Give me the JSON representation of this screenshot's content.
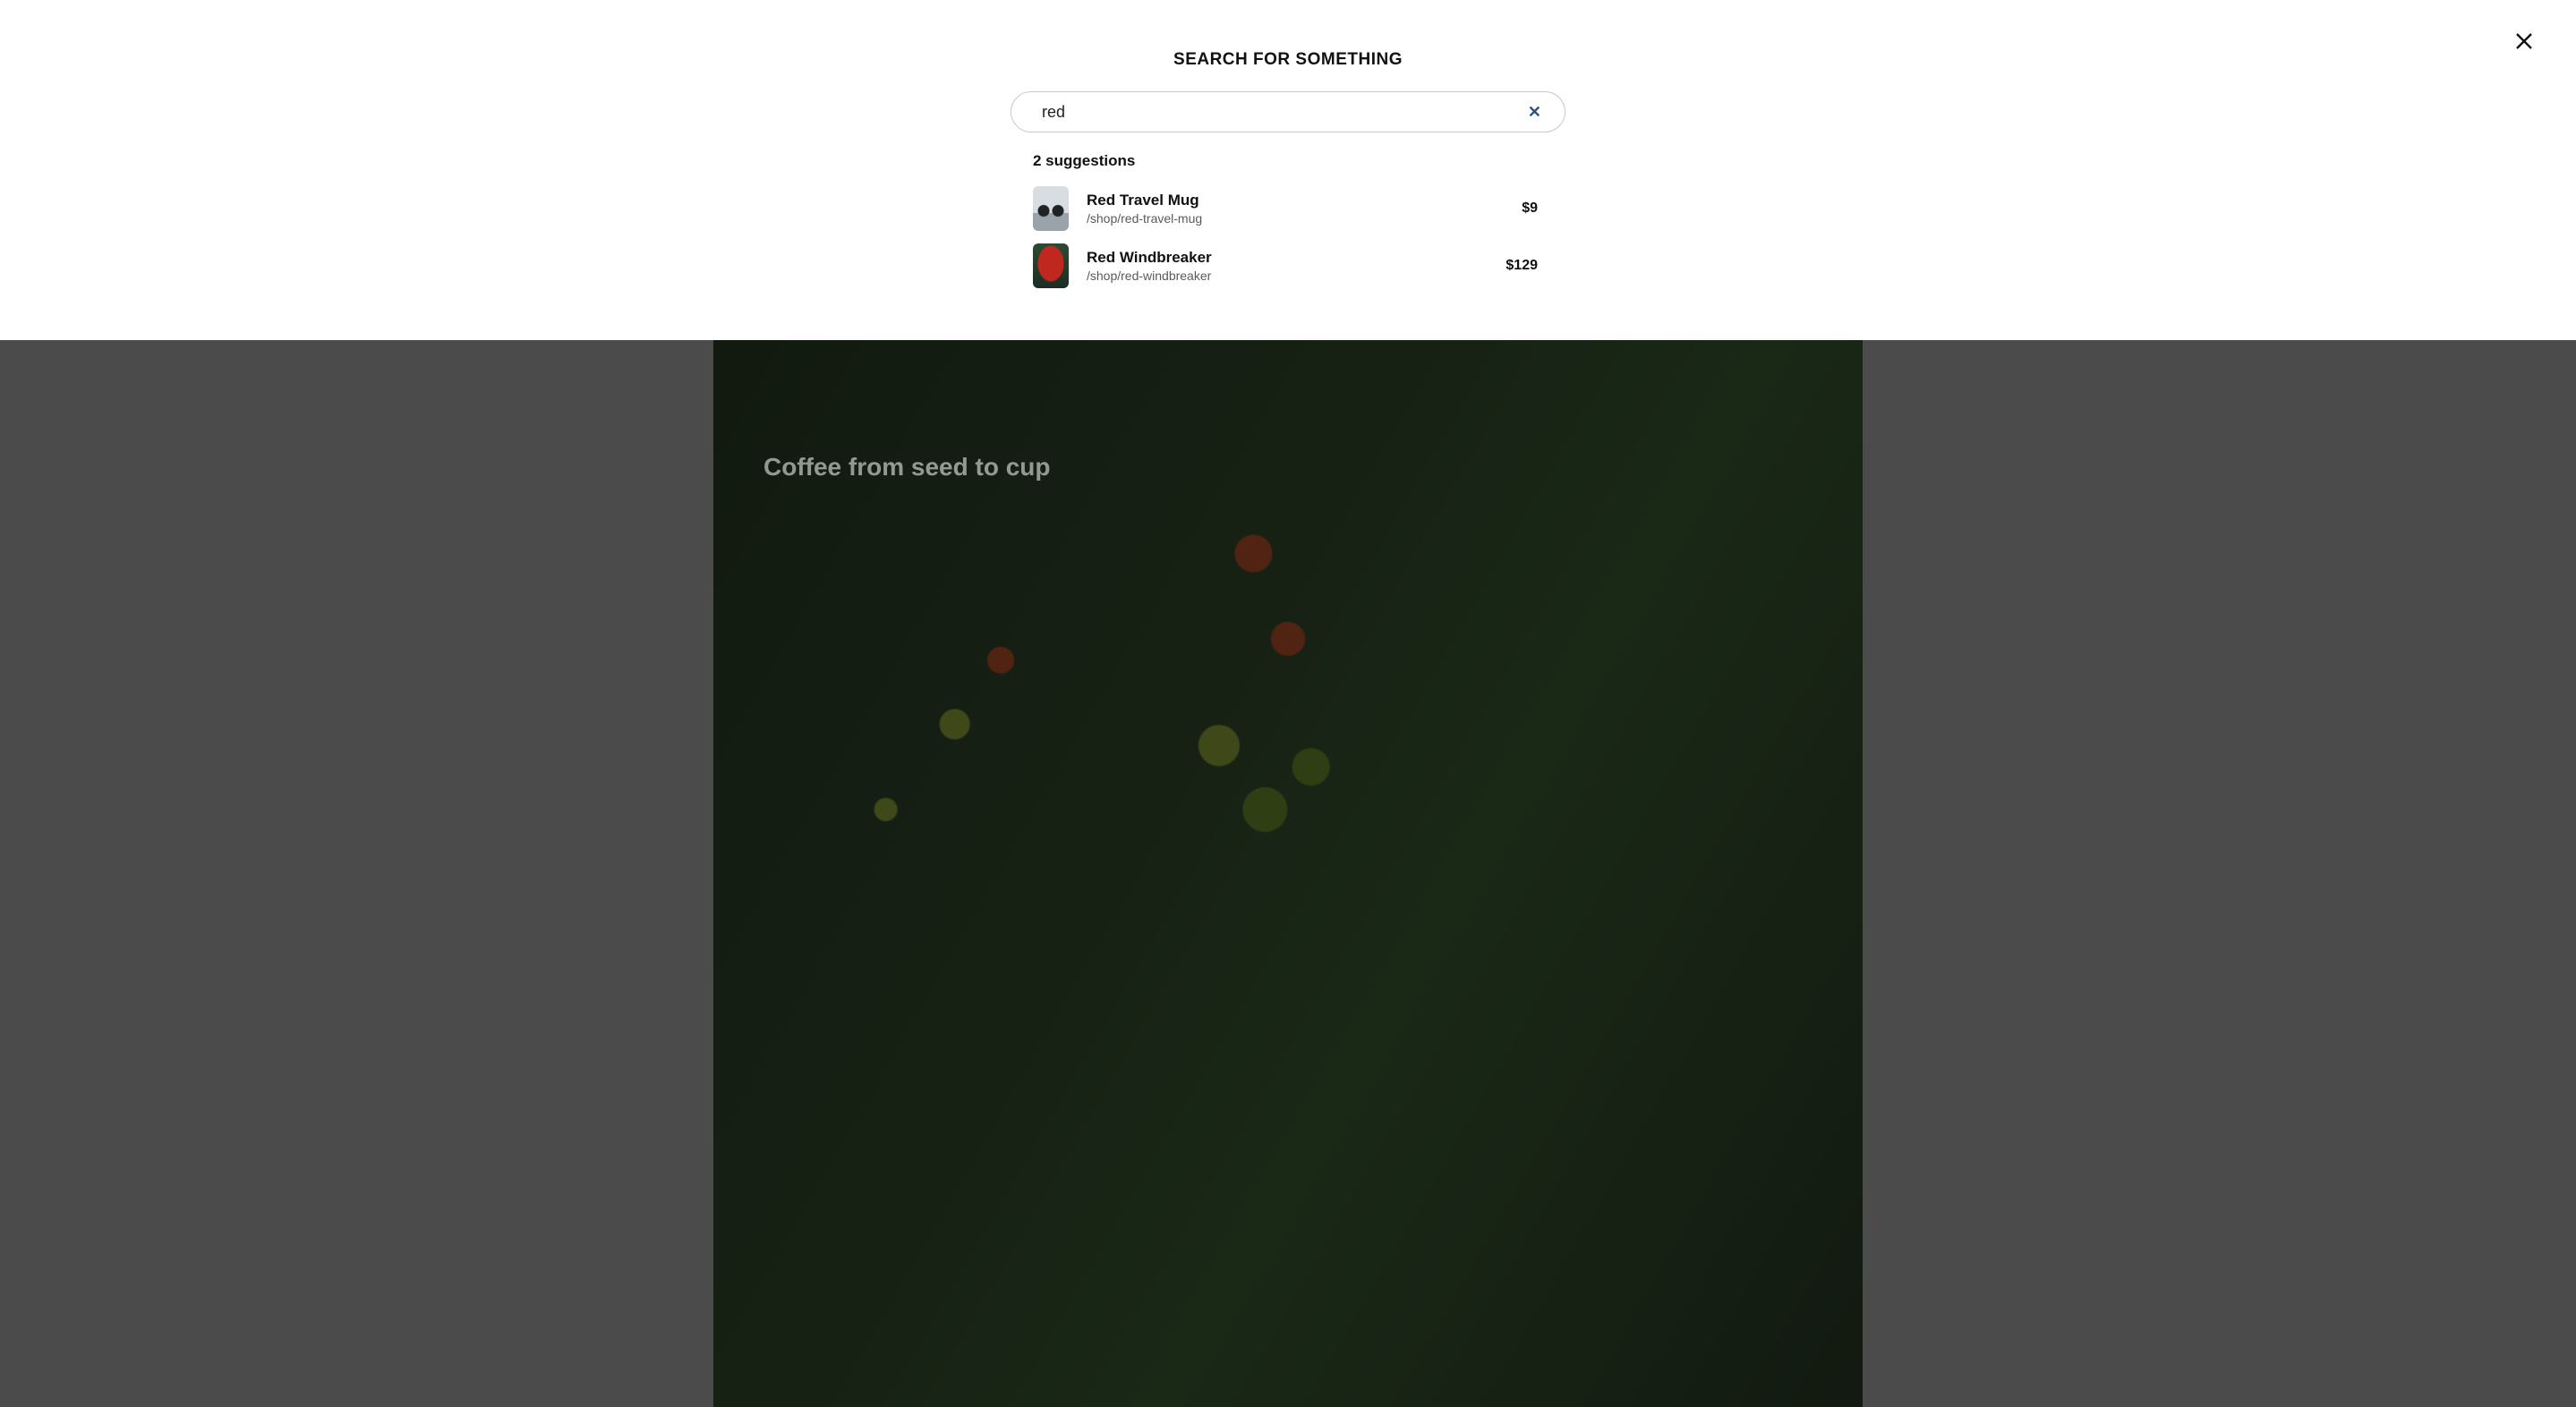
{
  "hero": {
    "title": "Coffee from seed to cup"
  },
  "search": {
    "heading": "SEARCH FOR SOMETHING",
    "value": "red",
    "placeholder": "",
    "clear_icon": "close-icon",
    "suggestions_label": "2 suggestions",
    "suggestions": [
      {
        "title": "Red Travel Mug",
        "path": "/shop/red-travel-mug",
        "price": "$9"
      },
      {
        "title": "Red Windbreaker",
        "path": "/shop/red-windbreaker",
        "price": "$129"
      }
    ]
  },
  "colors": {
    "clear_icon": "#2d4f8f",
    "text": "#111111",
    "muted": "#5a5a5a",
    "border": "#c9c9c9"
  }
}
